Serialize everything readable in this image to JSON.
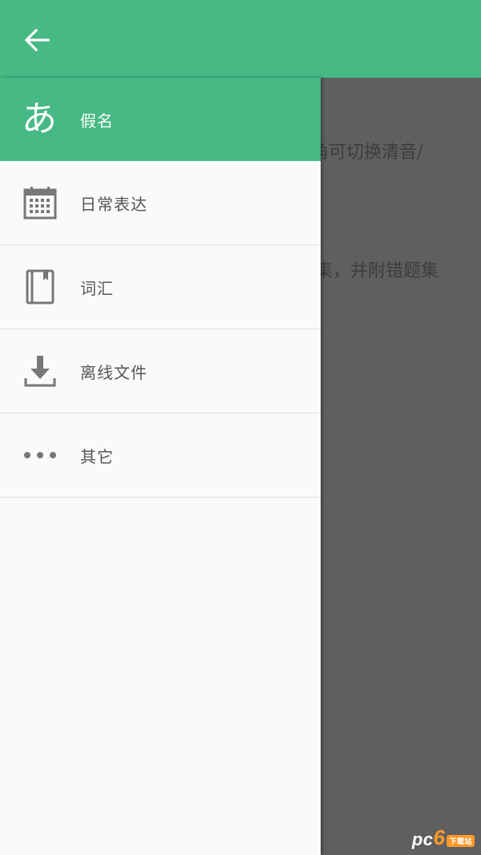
{
  "app_bar": {
    "back_icon": "arrow-left-icon",
    "color": "#46b985"
  },
  "main": {
    "line1": "角可切换清音/",
    "line2": "集，并附错题集"
  },
  "drawer": {
    "items": [
      {
        "label": "假名",
        "icon": "hiragana-a-icon",
        "glyph": "あ",
        "active": true
      },
      {
        "label": "日常表达",
        "icon": "calendar-icon",
        "active": false
      },
      {
        "label": "词汇",
        "icon": "book-icon",
        "active": false
      },
      {
        "label": "离线文件",
        "icon": "download-icon",
        "active": false
      },
      {
        "label": "其它",
        "icon": "more-horizontal-icon",
        "active": false
      }
    ]
  },
  "watermark": {
    "pc": "pc",
    "num": "6",
    "badge": "下载站"
  }
}
